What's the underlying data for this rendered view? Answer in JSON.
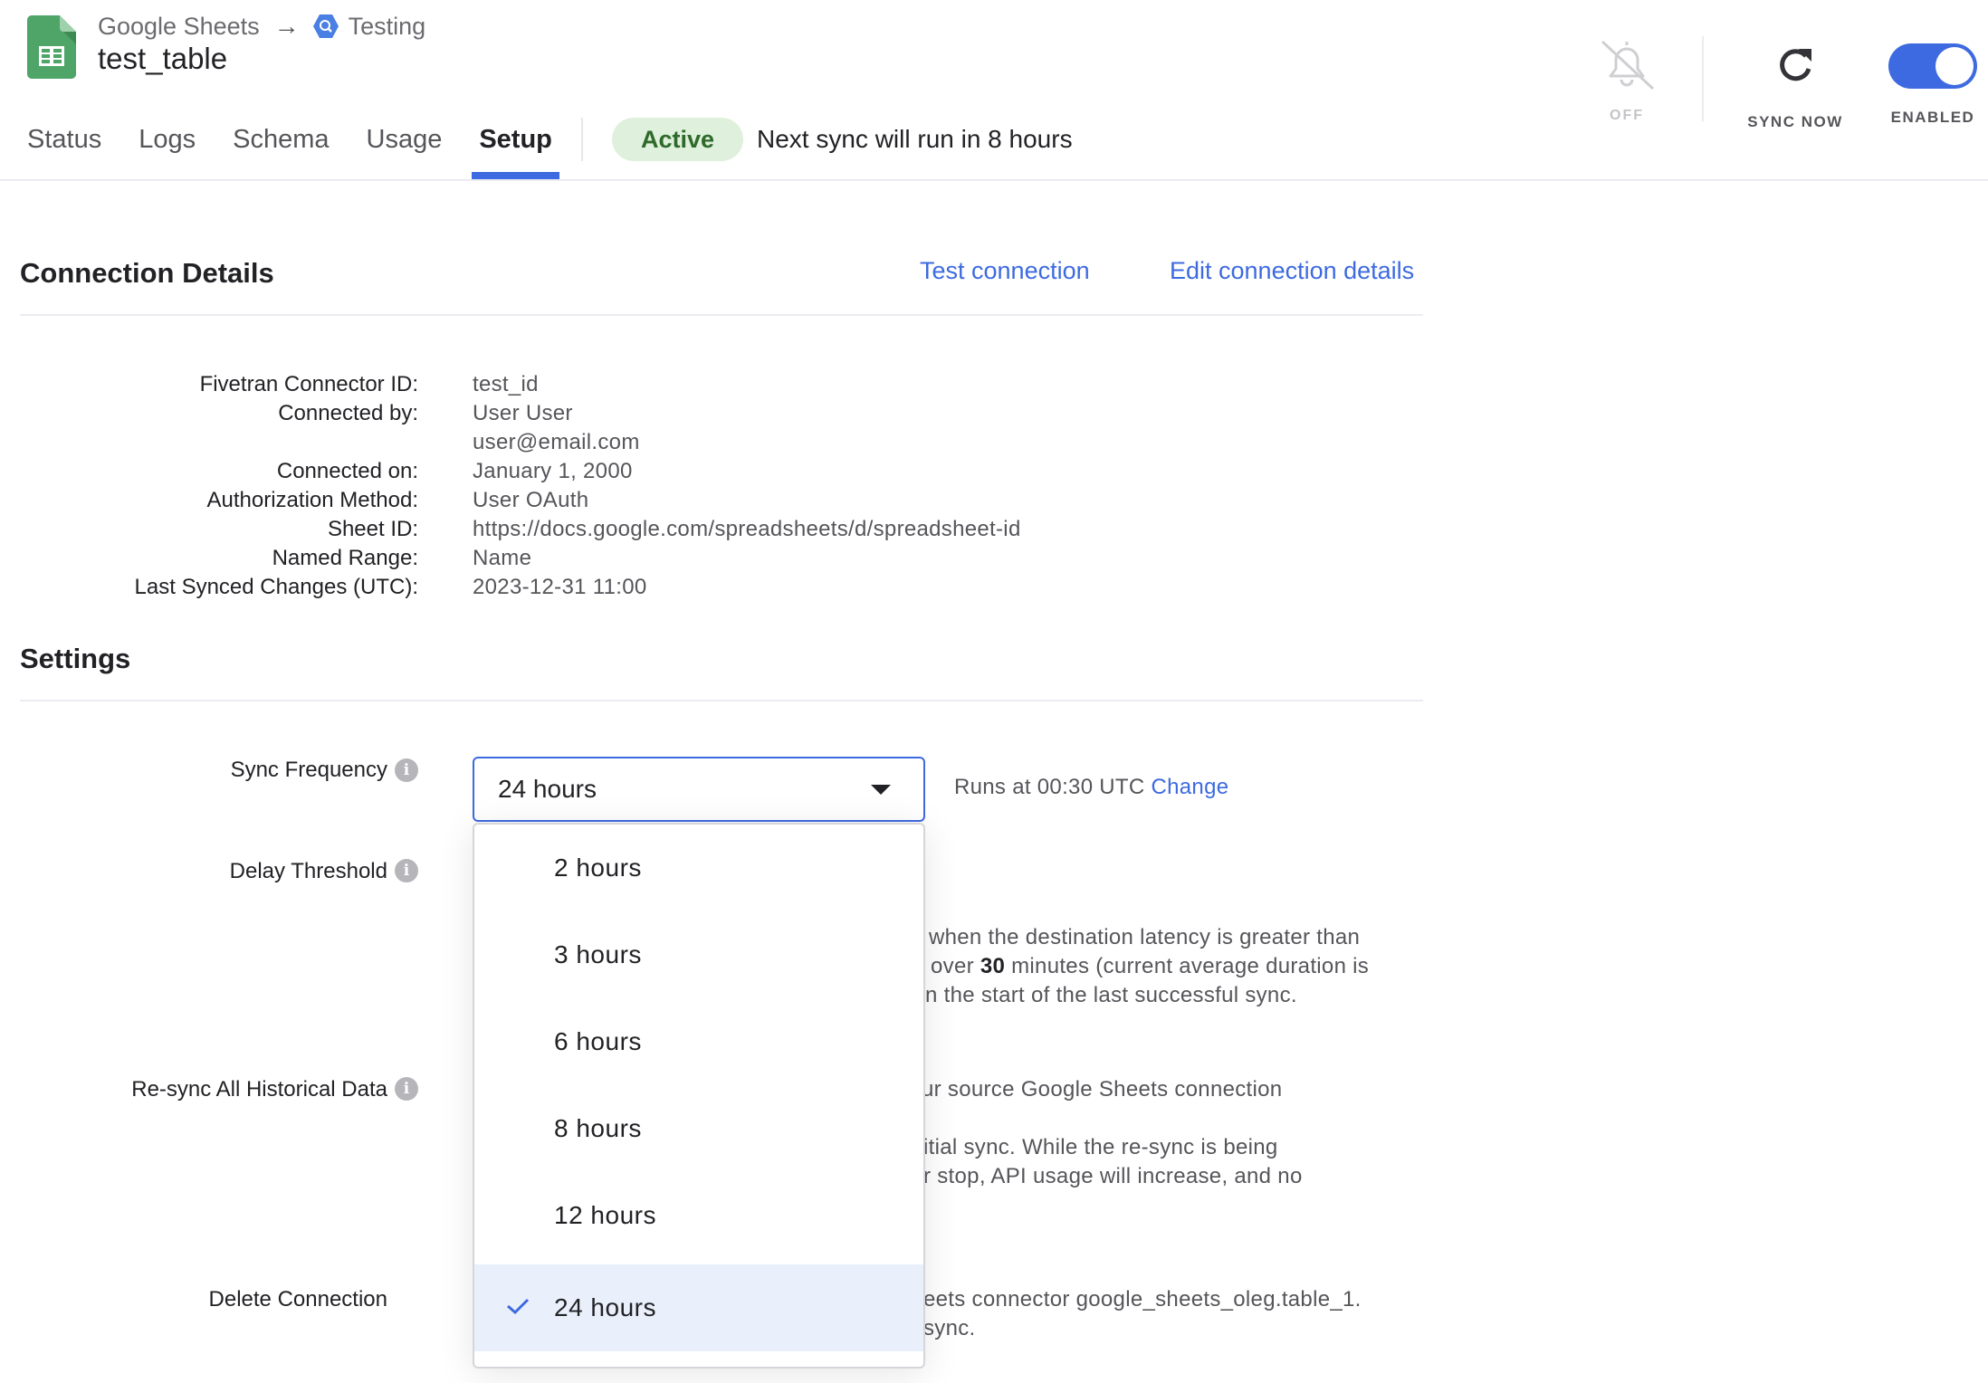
{
  "header": {
    "source_name": "Google Sheets",
    "destination_name": "Testing",
    "title": "test_table",
    "tabs": [
      {
        "label": "Status",
        "active": false
      },
      {
        "label": "Logs",
        "active": false
      },
      {
        "label": "Schema",
        "active": false
      },
      {
        "label": "Usage",
        "active": false
      },
      {
        "label": "Setup",
        "active": true
      }
    ],
    "status_badge": "Active",
    "next_sync": "Next sync will run in 8 hours",
    "notifications_label": "OFF",
    "sync_now_label": "SYNC NOW",
    "enabled_label": "ENABLED",
    "enabled": true
  },
  "connection_details": {
    "title": "Connection Details",
    "test_link": "Test connection",
    "edit_link": "Edit connection details",
    "rows": [
      {
        "label": "Fivetran Connector ID:",
        "value": "test_id"
      },
      {
        "label": "Connected by:",
        "value": "User User"
      },
      {
        "label": "",
        "value": "user@email.com"
      },
      {
        "label": "Connected on:",
        "value": "January 1, 2000"
      },
      {
        "label": "Authorization Method:",
        "value": "User OAuth"
      },
      {
        "label": "Sheet ID:",
        "value": "https://docs.google.com/spreadsheets/d/spreadsheet-id"
      },
      {
        "label": "Named Range:",
        "value": "Name"
      },
      {
        "label": "Last Synced Changes (UTC):",
        "value": "2023-12-31 11:00"
      }
    ]
  },
  "settings": {
    "title": "Settings",
    "sync_frequency": {
      "label": "Sync Frequency",
      "selected": "24 hours",
      "runs_at": "Runs at 00:30 UTC",
      "change_link": "Change",
      "options": [
        {
          "label": "2 hours",
          "selected": false
        },
        {
          "label": "3 hours",
          "selected": false
        },
        {
          "label": "6 hours",
          "selected": false
        },
        {
          "label": "8 hours",
          "selected": false
        },
        {
          "label": "12 hours",
          "selected": false
        },
        {
          "label": "24 hours",
          "selected": true
        }
      ]
    },
    "delay_threshold": {
      "label": "Delay Threshold",
      "desc_line1": "when the destination latency is greater than",
      "desc_line2_pre": "over",
      "desc_line2_bold": "30",
      "desc_line2_post": "minutes (current average duration is",
      "desc_line3": "n the start of the last successful sync."
    },
    "resync": {
      "label": "Re-sync All Historical Data",
      "link": "ur source Google Sheets connection",
      "desc_line1": "itial sync. While the re-sync is being",
      "desc_line2": "r stop, API usage will increase, and no"
    },
    "delete": {
      "label": "Delete Connection",
      "link": "eets connector google_sheets_oleg.table_1.",
      "desc_line1": "sync."
    }
  },
  "colors": {
    "accent": "#3d6ae0",
    "active_badge_bg": "#dff0dc",
    "active_badge_text": "#2f6a2a",
    "sheets_green": "#23a566"
  }
}
